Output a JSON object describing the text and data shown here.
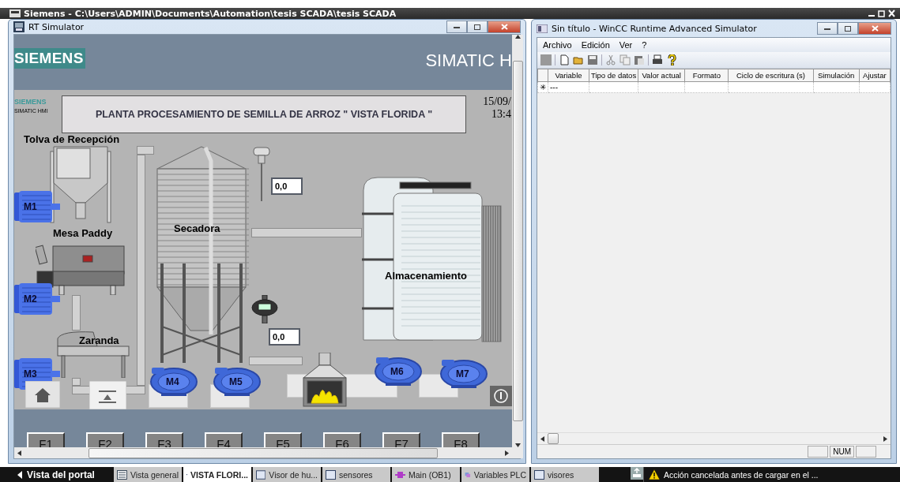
{
  "top_bar": {
    "title": "Siemens  -  C:\\Users\\ADMIN\\Documents\\Automation\\tesis SCADA\\tesis SCADA"
  },
  "rt_simulator": {
    "title": "RT Simulator",
    "brand": "SIEMENS",
    "product": "SIMATIC H",
    "side_brand": "SIEMENS",
    "side_product": "SIMATIC HMI",
    "screen_title": "PLANTA PROCESAMIENTO DE SEMILLA DE ARROZ \" VISTA FLORIDA \"",
    "date": "15/09/",
    "time": "13:4",
    "labels": [
      "Tolva de Recepción",
      "Mesa Paddy",
      "Secadora",
      "Zaranda",
      "Almacenamiento"
    ],
    "motors": [
      {
        "label": "M1",
        "kind": "electric"
      },
      {
        "label": "M2",
        "kind": "electric"
      },
      {
        "label": "M3",
        "kind": "electric"
      },
      {
        "label": "M4",
        "kind": "blower"
      },
      {
        "label": "M5",
        "kind": "blower"
      },
      {
        "label": "M6",
        "kind": "blower"
      },
      {
        "label": "M7",
        "kind": "blower"
      }
    ],
    "readings": [
      "0,0",
      "0,0"
    ],
    "function_keys": [
      "F1",
      "F2",
      "F3",
      "F4",
      "F5",
      "F6",
      "F7",
      "F8"
    ]
  },
  "wincc_simulator": {
    "title": "Sin título - WinCC Runtime Advanced Simulator",
    "menu": [
      "Archivo",
      "Edición",
      "Ver",
      "?"
    ],
    "table": {
      "columns": [
        "Variable",
        "Tipo de datos",
        "Valor actual",
        "Formato",
        "Ciclo de escritura (s)",
        "Simulación",
        "Ajustar"
      ],
      "rows": [
        {
          "marker": "✳",
          "variable": "---"
        }
      ]
    },
    "status": "NUM"
  },
  "taskbar": {
    "portal_button": "Vista del portal",
    "tabs": [
      {
        "label": "Vista general",
        "kind": "overview",
        "selected": false
      },
      {
        "label": "VISTA FLORI...",
        "kind": "screen",
        "selected": true
      },
      {
        "label": "Visor de hu...",
        "kind": "screen",
        "selected": false
      },
      {
        "label": "sensores",
        "kind": "screen",
        "selected": false
      },
      {
        "label": "Main (OB1)",
        "kind": "block",
        "selected": false
      },
      {
        "label": "Variables PLC",
        "kind": "tags",
        "selected": false
      },
      {
        "label": "visores",
        "kind": "screen",
        "selected": false
      }
    ],
    "notification": "Acción cancelada antes de cargar en el ..."
  }
}
